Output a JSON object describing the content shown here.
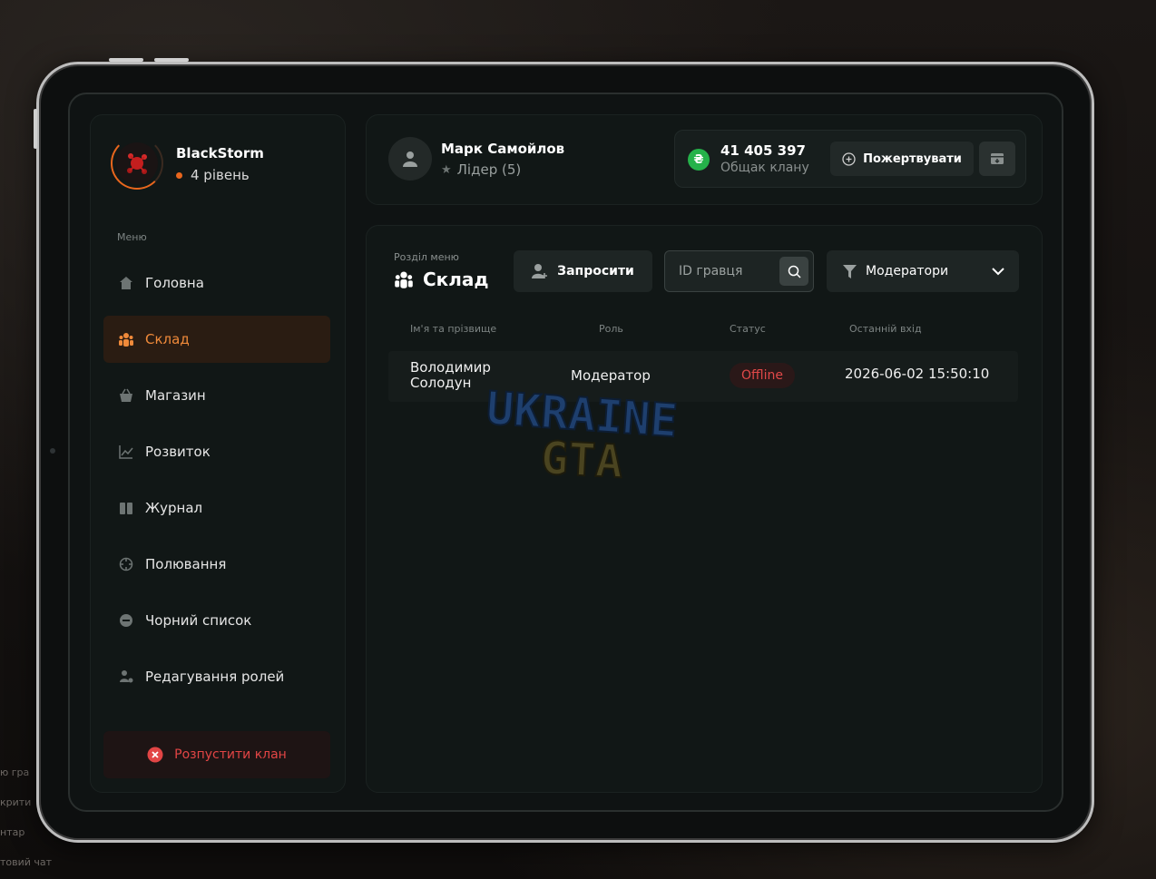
{
  "background": {
    "hints": [
      "ю гра",
      "крити",
      "нтар",
      "товий чат"
    ]
  },
  "clan": {
    "name": "BlackStorm",
    "level": "4 рівень"
  },
  "sidebar": {
    "menu_title": "Меню",
    "items": [
      {
        "label": "Головна",
        "icon": "home-icon"
      },
      {
        "label": "Склад",
        "icon": "people-icon",
        "active": true
      },
      {
        "label": "Магазин",
        "icon": "basket-icon"
      },
      {
        "label": "Розвиток",
        "icon": "chart-icon"
      },
      {
        "label": "Журнал",
        "icon": "book-icon"
      },
      {
        "label": "Полювання",
        "icon": "crosshair-icon"
      },
      {
        "label": "Чорний список",
        "icon": "block-icon"
      },
      {
        "label": "Редагування ролей",
        "icon": "user-gear-icon"
      }
    ],
    "disband_label": "Розпустити клан"
  },
  "header": {
    "user_name": "Марк Самойлов",
    "user_role": "Лідер (5)",
    "money_value": "41 405 397",
    "money_label": "Общак клану",
    "coin_symbol": "₴",
    "donate_label": "Пожертвувати"
  },
  "main": {
    "section_label": "Розділ меню",
    "section_title": "Склад",
    "invite_label": "Запросити",
    "search_placeholder": "ID гравця",
    "filter_label": "Модератори",
    "columns": [
      "Ім'я та прізвище",
      "Роль",
      "Статус",
      "Останній вхід"
    ],
    "rows": [
      {
        "name_line1": "Володимир",
        "name_line2": "Солодун",
        "role": "Модератор",
        "status": "Offline",
        "last_login": "2026-06-02 15:50:10"
      }
    ]
  },
  "watermark": {
    "line1": "UKRAINE",
    "line2": "GTA"
  },
  "colors": {
    "accent": "#e8661d",
    "danger": "#e04848",
    "money": "#25b24a"
  }
}
